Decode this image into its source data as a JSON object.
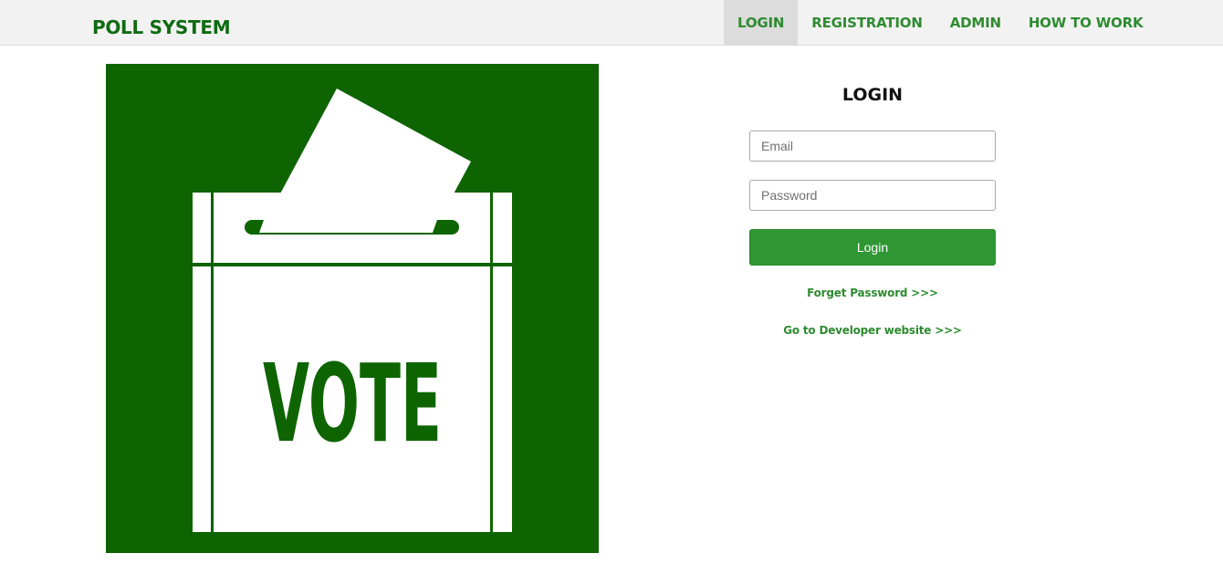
{
  "header": {
    "brand": "POLL SYSTEM",
    "nav": [
      {
        "label": "LOGIN",
        "active": true
      },
      {
        "label": "REGISTRATION",
        "active": false
      },
      {
        "label": "ADMIN",
        "active": false
      },
      {
        "label": "HOW TO WORK",
        "active": false
      }
    ]
  },
  "hero": {
    "image_text": "VOTE",
    "icon": "ballot-box-icon",
    "background_color": "#0e6400"
  },
  "login": {
    "title": "LOGIN",
    "email_placeholder": "Email",
    "password_placeholder": "Password",
    "button_label": "Login",
    "forget_link": "Forget Password >>>",
    "developer_link": "Go to Developer website >>>"
  },
  "colors": {
    "accent": "#2e8b30",
    "brand": "#106b12",
    "button": "#2f9634"
  }
}
